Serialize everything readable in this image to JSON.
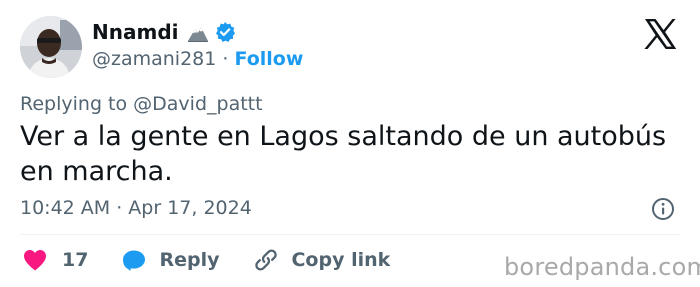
{
  "author": {
    "display_name": "Nnamdi",
    "handle": "@zamani281",
    "separator": "·",
    "follow_label": "Follow",
    "avatar_icon": "avatar-photo",
    "name_emoji_icon": "mountain-emoji-icon",
    "verified_icon": "verified-badge-icon",
    "verified_color": "#1d9bf0"
  },
  "header": {
    "platform_icon": "x-logo-icon"
  },
  "tweet": {
    "reply_context": "Replying to @David_pattt",
    "text": "Ver a la gente en Lagos saltando de un autobús en marcha.",
    "timestamp": "10:42 AM · Apr 17, 2024",
    "info_icon": "info-icon"
  },
  "actions": {
    "like_count": "17",
    "like_color": "#f91880",
    "reply_label": "Reply",
    "reply_color": "#1d9bf0",
    "copy_link_label": "Copy link"
  },
  "watermark": "boredpanda.com",
  "colors": {
    "text_primary": "#0f1419",
    "text_secondary": "#536471",
    "accent": "#1d9bf0",
    "divider": "#eff3f4"
  }
}
